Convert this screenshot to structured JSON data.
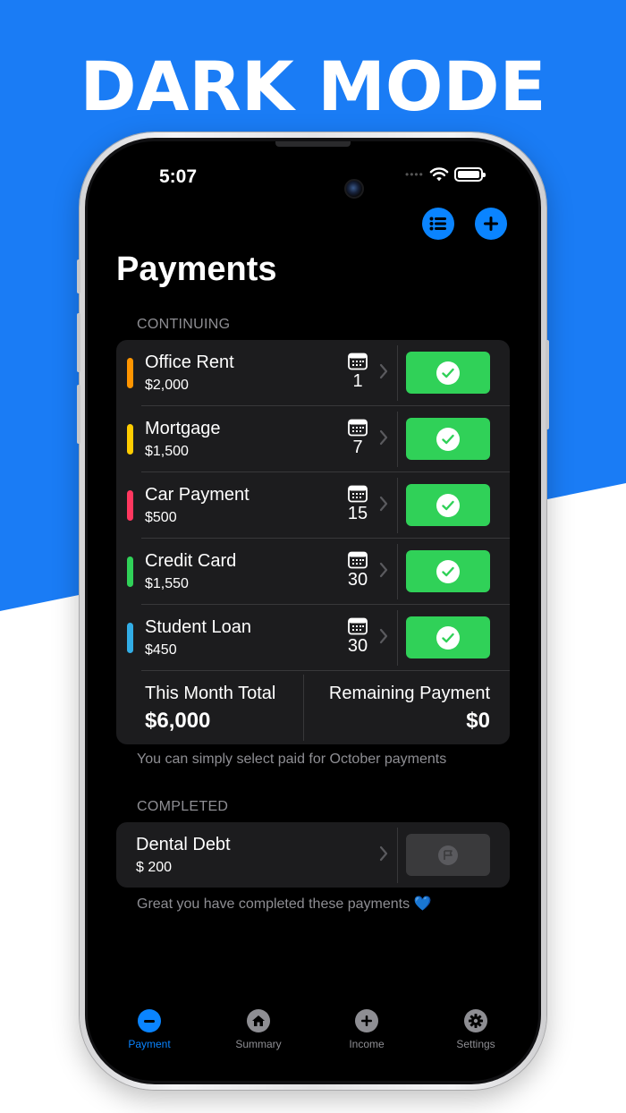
{
  "banner": {
    "headline": "DARK MODE",
    "colors": {
      "blue": "#1a7cf5",
      "white": "#ffffff"
    }
  },
  "status_bar": {
    "time": "5:07"
  },
  "toolbar": {
    "list_icon": "list-icon",
    "add_icon": "plus-icon"
  },
  "page": {
    "title": "Payments"
  },
  "continuing": {
    "label": "CONTINUING",
    "items": [
      {
        "name": "Office Rent",
        "amount": "$2,000",
        "day": "1",
        "color": "#ff9500"
      },
      {
        "name": "Mortgage",
        "amount": "$1,500",
        "day": "7",
        "color": "#ffcc00"
      },
      {
        "name": "Car Payment",
        "amount": "$500",
        "day": "15",
        "color": "#ff375f"
      },
      {
        "name": "Credit Card",
        "amount": "$1,550",
        "day": "30",
        "color": "#30d158"
      },
      {
        "name": "Student Loan",
        "amount": "$450",
        "day": "30",
        "color": "#32ade6"
      }
    ],
    "totals": {
      "left_label": "This Month Total",
      "left_value": "$6,000",
      "right_label": "Remaining Payment",
      "right_value": "$0"
    },
    "footnote": "You can simply select paid for October payments"
  },
  "completed": {
    "label": "COMPLETED",
    "items": [
      {
        "name": "Dental Debt",
        "amount": "$ 200"
      }
    ],
    "footnote": "Great you have completed these payments 💙"
  },
  "tabs": [
    {
      "label": "Payment",
      "icon": "minus-circle-icon",
      "active": true
    },
    {
      "label": "Summary",
      "icon": "house-icon",
      "active": false
    },
    {
      "label": "Income",
      "icon": "plus-circle-icon",
      "active": false
    },
    {
      "label": "Settings",
      "icon": "gear-icon",
      "active": false
    }
  ],
  "colors": {
    "accent": "#0a84ff",
    "paid_green": "#30d158",
    "card_bg": "#1c1c1e",
    "secondary_text": "#8e8e93"
  }
}
